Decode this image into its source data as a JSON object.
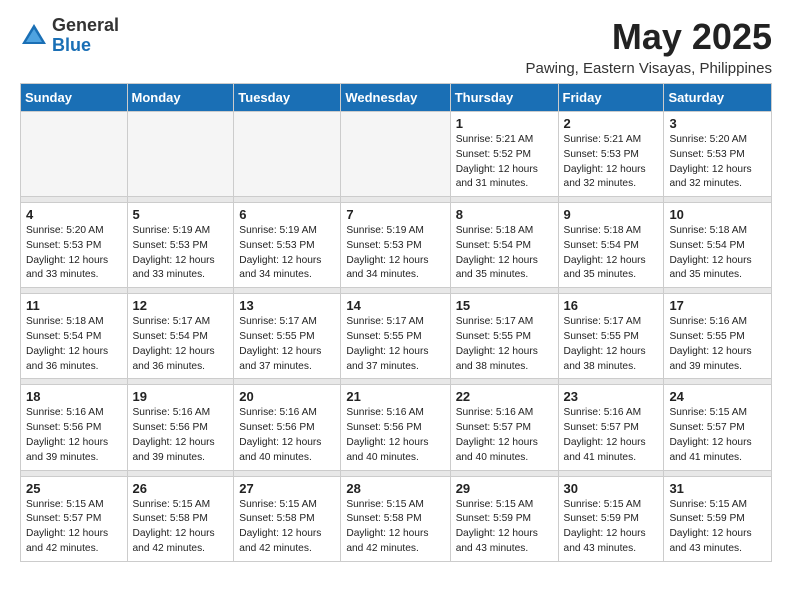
{
  "logo": {
    "general": "General",
    "blue": "Blue"
  },
  "title": {
    "month_year": "May 2025",
    "location": "Pawing, Eastern Visayas, Philippines"
  },
  "weekdays": [
    "Sunday",
    "Monday",
    "Tuesday",
    "Wednesday",
    "Thursday",
    "Friday",
    "Saturday"
  ],
  "weeks": [
    [
      {
        "day": "",
        "info": ""
      },
      {
        "day": "",
        "info": ""
      },
      {
        "day": "",
        "info": ""
      },
      {
        "day": "",
        "info": ""
      },
      {
        "day": "1",
        "info": "Sunrise: 5:21 AM\nSunset: 5:52 PM\nDaylight: 12 hours\nand 31 minutes."
      },
      {
        "day": "2",
        "info": "Sunrise: 5:21 AM\nSunset: 5:53 PM\nDaylight: 12 hours\nand 32 minutes."
      },
      {
        "day": "3",
        "info": "Sunrise: 5:20 AM\nSunset: 5:53 PM\nDaylight: 12 hours\nand 32 minutes."
      }
    ],
    [
      {
        "day": "4",
        "info": "Sunrise: 5:20 AM\nSunset: 5:53 PM\nDaylight: 12 hours\nand 33 minutes."
      },
      {
        "day": "5",
        "info": "Sunrise: 5:19 AM\nSunset: 5:53 PM\nDaylight: 12 hours\nand 33 minutes."
      },
      {
        "day": "6",
        "info": "Sunrise: 5:19 AM\nSunset: 5:53 PM\nDaylight: 12 hours\nand 34 minutes."
      },
      {
        "day": "7",
        "info": "Sunrise: 5:19 AM\nSunset: 5:53 PM\nDaylight: 12 hours\nand 34 minutes."
      },
      {
        "day": "8",
        "info": "Sunrise: 5:18 AM\nSunset: 5:54 PM\nDaylight: 12 hours\nand 35 minutes."
      },
      {
        "day": "9",
        "info": "Sunrise: 5:18 AM\nSunset: 5:54 PM\nDaylight: 12 hours\nand 35 minutes."
      },
      {
        "day": "10",
        "info": "Sunrise: 5:18 AM\nSunset: 5:54 PM\nDaylight: 12 hours\nand 35 minutes."
      }
    ],
    [
      {
        "day": "11",
        "info": "Sunrise: 5:18 AM\nSunset: 5:54 PM\nDaylight: 12 hours\nand 36 minutes."
      },
      {
        "day": "12",
        "info": "Sunrise: 5:17 AM\nSunset: 5:54 PM\nDaylight: 12 hours\nand 36 minutes."
      },
      {
        "day": "13",
        "info": "Sunrise: 5:17 AM\nSunset: 5:55 PM\nDaylight: 12 hours\nand 37 minutes."
      },
      {
        "day": "14",
        "info": "Sunrise: 5:17 AM\nSunset: 5:55 PM\nDaylight: 12 hours\nand 37 minutes."
      },
      {
        "day": "15",
        "info": "Sunrise: 5:17 AM\nSunset: 5:55 PM\nDaylight: 12 hours\nand 38 minutes."
      },
      {
        "day": "16",
        "info": "Sunrise: 5:17 AM\nSunset: 5:55 PM\nDaylight: 12 hours\nand 38 minutes."
      },
      {
        "day": "17",
        "info": "Sunrise: 5:16 AM\nSunset: 5:55 PM\nDaylight: 12 hours\nand 39 minutes."
      }
    ],
    [
      {
        "day": "18",
        "info": "Sunrise: 5:16 AM\nSunset: 5:56 PM\nDaylight: 12 hours\nand 39 minutes."
      },
      {
        "day": "19",
        "info": "Sunrise: 5:16 AM\nSunset: 5:56 PM\nDaylight: 12 hours\nand 39 minutes."
      },
      {
        "day": "20",
        "info": "Sunrise: 5:16 AM\nSunset: 5:56 PM\nDaylight: 12 hours\nand 40 minutes."
      },
      {
        "day": "21",
        "info": "Sunrise: 5:16 AM\nSunset: 5:56 PM\nDaylight: 12 hours\nand 40 minutes."
      },
      {
        "day": "22",
        "info": "Sunrise: 5:16 AM\nSunset: 5:57 PM\nDaylight: 12 hours\nand 40 minutes."
      },
      {
        "day": "23",
        "info": "Sunrise: 5:16 AM\nSunset: 5:57 PM\nDaylight: 12 hours\nand 41 minutes."
      },
      {
        "day": "24",
        "info": "Sunrise: 5:15 AM\nSunset: 5:57 PM\nDaylight: 12 hours\nand 41 minutes."
      }
    ],
    [
      {
        "day": "25",
        "info": "Sunrise: 5:15 AM\nSunset: 5:57 PM\nDaylight: 12 hours\nand 42 minutes."
      },
      {
        "day": "26",
        "info": "Sunrise: 5:15 AM\nSunset: 5:58 PM\nDaylight: 12 hours\nand 42 minutes."
      },
      {
        "day": "27",
        "info": "Sunrise: 5:15 AM\nSunset: 5:58 PM\nDaylight: 12 hours\nand 42 minutes."
      },
      {
        "day": "28",
        "info": "Sunrise: 5:15 AM\nSunset: 5:58 PM\nDaylight: 12 hours\nand 42 minutes."
      },
      {
        "day": "29",
        "info": "Sunrise: 5:15 AM\nSunset: 5:59 PM\nDaylight: 12 hours\nand 43 minutes."
      },
      {
        "day": "30",
        "info": "Sunrise: 5:15 AM\nSunset: 5:59 PM\nDaylight: 12 hours\nand 43 minutes."
      },
      {
        "day": "31",
        "info": "Sunrise: 5:15 AM\nSunset: 5:59 PM\nDaylight: 12 hours\nand 43 minutes."
      }
    ]
  ]
}
